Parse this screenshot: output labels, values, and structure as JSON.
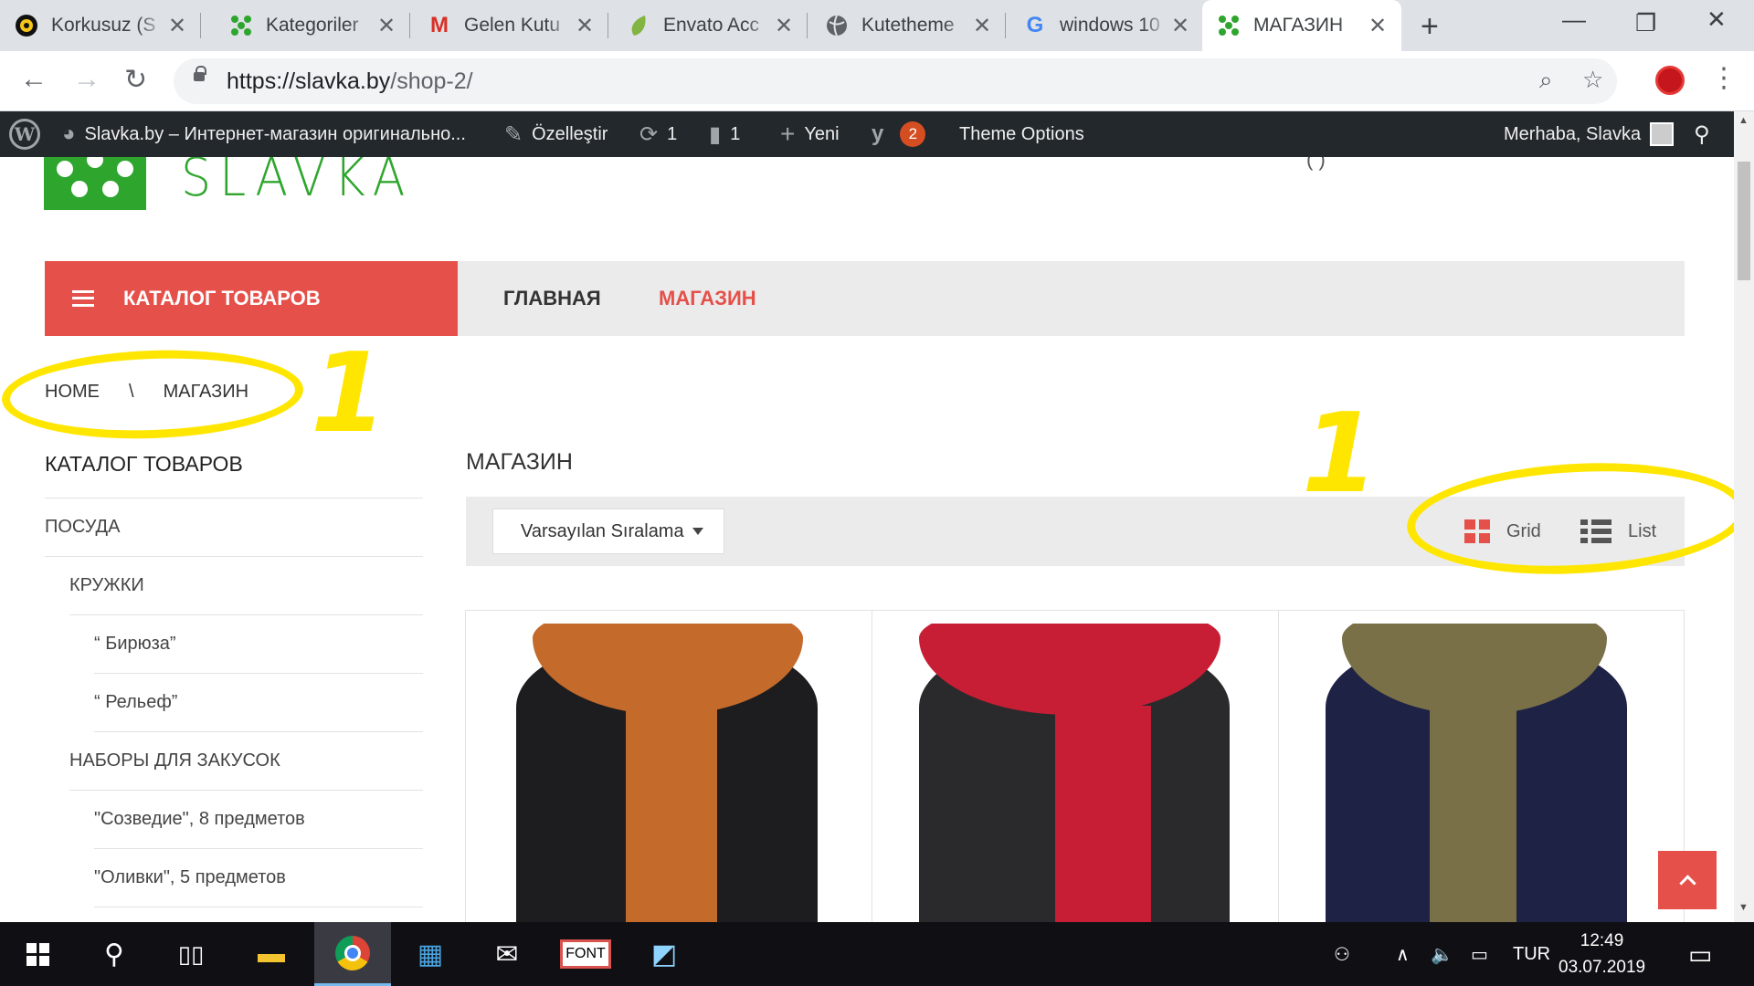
{
  "browser": {
    "tabs": [
      {
        "title": "Korkusuz (S",
        "icon": "korkusuz-icon"
      },
      {
        "title": "Kategoriler",
        "icon": "slavka-favicon"
      },
      {
        "title": "Gelen Kutu",
        "icon": "gmail-icon"
      },
      {
        "title": "Envato Acc",
        "icon": "envato-icon"
      },
      {
        "title": "Kutetheme",
        "icon": "globe-icon"
      },
      {
        "title": "windows 10",
        "icon": "google-icon"
      },
      {
        "title": "МАГАЗИН",
        "icon": "slavka-favicon"
      }
    ],
    "url_domain": "https://slavka.by",
    "url_path": "/shop-2/"
  },
  "wp_admin_bar": {
    "site_name": "Slavka.by – Интернет-магазин оригинально...",
    "customize": "Özelleştir",
    "updates_count": "1",
    "comments_count": "1",
    "new_label": "Yeni",
    "yoast_count": "2",
    "theme_options": "Theme Options",
    "greeting": "Merhaba, Slavka"
  },
  "site": {
    "logo_text": "SLAVKA",
    "top_right_fragment": "( )",
    "nav": {
      "catalog_button": "КАТАЛОГ ТОВАРОВ",
      "links": [
        "ГЛАВНАЯ",
        "МАГАЗИН"
      ],
      "active": "МАГАЗИН"
    },
    "breadcrumb": [
      "HOME",
      "\\",
      "МАГАЗИН"
    ],
    "sidebar": {
      "title": "КАТАЛОГ ТОВАРОВ",
      "items": [
        {
          "label": "ПОСУДА",
          "level": 0
        },
        {
          "label": "КРУЖКИ",
          "level": 1
        },
        {
          "label": "“ Бирюза”",
          "level": 2
        },
        {
          "label": "“ Рельеф”",
          "level": 2
        },
        {
          "label": "НАБОРЫ ДЛЯ ЗАКУСОК",
          "level": 1
        },
        {
          "label": "\"Созведие\", 8 предметов",
          "level": 2
        },
        {
          "label": "\"Оливки\", 5 предметов",
          "level": 2
        }
      ]
    },
    "shop": {
      "title": "МАГАЗИН",
      "sort_selected": "Varsayılan Sıralama",
      "view_grid": "Grid",
      "view_list": "List",
      "products": [
        {
          "scarf_color": "#c46a2a",
          "image": "orange scarf on black mannequin"
        },
        {
          "scarf_color": "#c81e35",
          "image": "red scarf on black mannequin"
        },
        {
          "scarf_color": "#7a7048",
          "image": "olive scarf on navy mannequin"
        }
      ]
    },
    "annotations": [
      "1",
      "1"
    ]
  },
  "taskbar": {
    "language": "TUR",
    "time": "12:49",
    "date": "03.07.2019"
  },
  "colors": {
    "accent": "#e5504a",
    "brand_green": "#2ea62e",
    "annotation_yellow": "#ffe600",
    "wp_bar": "#23282d"
  }
}
